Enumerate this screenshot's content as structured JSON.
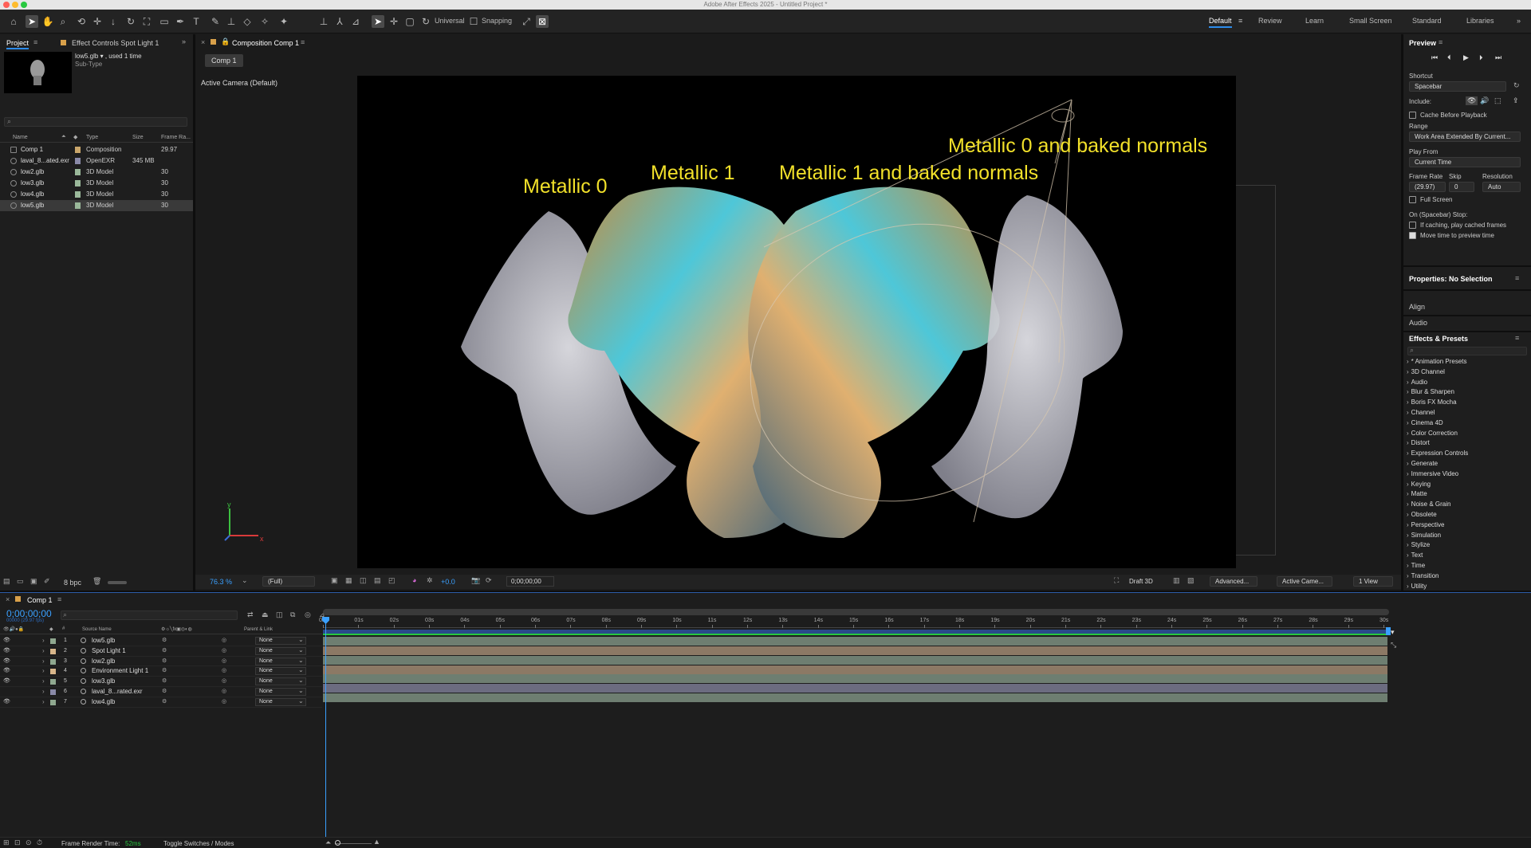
{
  "app_title": "Adobe After Effects 2025 - Untitled Project *",
  "toolbar": {
    "axis_mode": "Universal",
    "snapping": "Snapping",
    "workspaces": [
      "Default",
      "Review",
      "Learn",
      "Small Screen",
      "Standard",
      "Libraries"
    ]
  },
  "project": {
    "tab": "Project",
    "effect_tab": "Effect Controls Spot Light 1",
    "thumb_name": "low5.glb",
    "thumb_used": ", used 1 time",
    "thumb_sub": "Sub-Type",
    "cols": [
      "Name",
      "Type",
      "Size",
      "Frame Ra..."
    ],
    "items": [
      {
        "name": "Comp 1",
        "type": "Composition",
        "size": "",
        "fr": "29.97",
        "color": "#c9a66b"
      },
      {
        "name": "laval_8...ated.exr",
        "type": "OpenEXR",
        "size": "345 MB",
        "fr": "",
        "color": "#8a8aa8"
      },
      {
        "name": "low2.glb",
        "type": "3D Model",
        "size": "",
        "fr": "30",
        "color": "#9ab89a"
      },
      {
        "name": "low3.glb",
        "type": "3D Model",
        "size": "",
        "fr": "30",
        "color": "#9ab89a"
      },
      {
        "name": "low4.glb",
        "type": "3D Model",
        "size": "",
        "fr": "30",
        "color": "#9ab89a"
      },
      {
        "name": "low5.glb",
        "type": "3D Model",
        "size": "",
        "fr": "30",
        "color": "#9ab89a"
      }
    ],
    "bpc": "8 bpc"
  },
  "comp": {
    "tab": "Composition Comp 1",
    "chip": "Comp 1",
    "camera": "Active Camera (Default)",
    "titles": [
      "Metallic 0",
      "Metallic 1",
      "Metallic 1 and baked normals",
      "Metallic 0 and baked normals"
    ],
    "zoom": "76.3 %",
    "resolution": "(Full)",
    "exposure": "+0.0",
    "timecode": "0;00;00;00",
    "draft": "Draft 3D",
    "renderer": "Advanced...",
    "camera_menu": "Active Came...",
    "views": "1 View"
  },
  "preview": {
    "title": "Preview",
    "shortcut_label": "Shortcut",
    "shortcut": "Spacebar",
    "include": "Include:",
    "cache": "Cache Before Playback",
    "range_label": "Range",
    "range": "Work Area Extended By Current...",
    "playfrom_label": "Play From",
    "playfrom": "Current Time",
    "framerate_label": "Frame Rate",
    "skip_label": "Skip",
    "res_label": "Resolution",
    "framerate": "(29.97)",
    "skip": "0",
    "res": "Auto",
    "fullscreen": "Full Screen",
    "stop_label": "On (Spacebar) Stop:",
    "stop1": "If caching, play cached frames",
    "stop2": "Move time to preview time"
  },
  "properties": {
    "title": "Properties: No Selection",
    "align": "Align",
    "audio": "Audio"
  },
  "effects": {
    "title": "Effects & Presets",
    "items": [
      "* Animation Presets",
      "3D Channel",
      "Audio",
      "Blur & Sharpen",
      "Boris FX Mocha",
      "Channel",
      "Cinema 4D",
      "Color Correction",
      "Distort",
      "Expression Controls",
      "Generate",
      "Immersive Video",
      "Keying",
      "Matte",
      "Noise & Grain",
      "Obsolete",
      "Perspective",
      "Simulation",
      "Stylize",
      "Text",
      "Time",
      "Transition",
      "Utility"
    ]
  },
  "timeline": {
    "tab": "Comp 1",
    "timecode": "0;00;00;00",
    "fps": "00000 (29.97 fps)",
    "col_source": "Source Name",
    "col_parent": "Parent & Link",
    "ruler": [
      "0s",
      "01s",
      "02s",
      "03s",
      "04s",
      "05s",
      "06s",
      "07s",
      "08s",
      "09s",
      "10s",
      "11s",
      "12s",
      "13s",
      "14s",
      "15s",
      "16s",
      "17s",
      "18s",
      "19s",
      "20s",
      "21s",
      "22s",
      "23s",
      "24s",
      "25s",
      "26s",
      "27s",
      "28s",
      "29s",
      "30s"
    ],
    "layers": [
      {
        "num": "1",
        "name": "low5.glb",
        "parent": "None",
        "color": "#8fa88f",
        "bar": "#7d8f80"
      },
      {
        "num": "2",
        "name": "Spot Light 1",
        "parent": "None",
        "color": "#d8b68a",
        "bar": "#a08a72"
      },
      {
        "num": "3",
        "name": "low2.glb",
        "parent": "None",
        "color": "#8fa88f",
        "bar": "#7d8f80"
      },
      {
        "num": "4",
        "name": "Environment Light 1",
        "parent": "None",
        "color": "#d8b68a",
        "bar": "#a08a72"
      },
      {
        "num": "5",
        "name": "low3.glb",
        "parent": "None",
        "color": "#8fa88f",
        "bar": "#7d8f80"
      },
      {
        "num": "6",
        "name": "laval_8...rated.exr",
        "parent": "None",
        "color": "#8a8aa8",
        "bar": "#7a7a92"
      },
      {
        "num": "7",
        "name": "low4.glb",
        "parent": "None",
        "color": "#8fa88f",
        "bar": "#7d8f80"
      }
    ],
    "render_label": "Frame Render Time:",
    "render_value": "52ms",
    "toggle": "Toggle Switches / Modes"
  }
}
